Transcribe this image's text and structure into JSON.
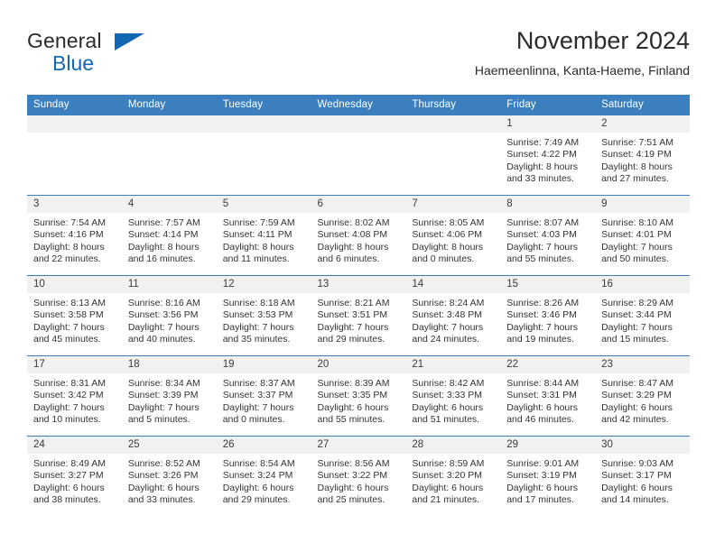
{
  "brand": {
    "line1": "General",
    "line2": "Blue",
    "flag_icon": "triangle-flag-icon",
    "color": "#1268b3"
  },
  "header": {
    "title": "November 2024",
    "subtitle": "Haemeenlinna, Kanta-Haeme, Finland"
  },
  "theme": {
    "header_blue": "#3c7fbf",
    "daynum_bg": "#f1f1f1",
    "text": "#333333"
  },
  "weekday_headers": [
    "Sunday",
    "Monday",
    "Tuesday",
    "Wednesday",
    "Thursday",
    "Friday",
    "Saturday"
  ],
  "weeks": [
    [
      {
        "day": "",
        "sunrise": "",
        "sunset": "",
        "daylight1": "",
        "daylight2": ""
      },
      {
        "day": "",
        "sunrise": "",
        "sunset": "",
        "daylight1": "",
        "daylight2": ""
      },
      {
        "day": "",
        "sunrise": "",
        "sunset": "",
        "daylight1": "",
        "daylight2": ""
      },
      {
        "day": "",
        "sunrise": "",
        "sunset": "",
        "daylight1": "",
        "daylight2": ""
      },
      {
        "day": "",
        "sunrise": "",
        "sunset": "",
        "daylight1": "",
        "daylight2": ""
      },
      {
        "day": "1",
        "sunrise": "Sunrise: 7:49 AM",
        "sunset": "Sunset: 4:22 PM",
        "daylight1": "Daylight: 8 hours",
        "daylight2": "and 33 minutes."
      },
      {
        "day": "2",
        "sunrise": "Sunrise: 7:51 AM",
        "sunset": "Sunset: 4:19 PM",
        "daylight1": "Daylight: 8 hours",
        "daylight2": "and 27 minutes."
      }
    ],
    [
      {
        "day": "3",
        "sunrise": "Sunrise: 7:54 AM",
        "sunset": "Sunset: 4:16 PM",
        "daylight1": "Daylight: 8 hours",
        "daylight2": "and 22 minutes."
      },
      {
        "day": "4",
        "sunrise": "Sunrise: 7:57 AM",
        "sunset": "Sunset: 4:14 PM",
        "daylight1": "Daylight: 8 hours",
        "daylight2": "and 16 minutes."
      },
      {
        "day": "5",
        "sunrise": "Sunrise: 7:59 AM",
        "sunset": "Sunset: 4:11 PM",
        "daylight1": "Daylight: 8 hours",
        "daylight2": "and 11 minutes."
      },
      {
        "day": "6",
        "sunrise": "Sunrise: 8:02 AM",
        "sunset": "Sunset: 4:08 PM",
        "daylight1": "Daylight: 8 hours",
        "daylight2": "and 6 minutes."
      },
      {
        "day": "7",
        "sunrise": "Sunrise: 8:05 AM",
        "sunset": "Sunset: 4:06 PM",
        "daylight1": "Daylight: 8 hours",
        "daylight2": "and 0 minutes."
      },
      {
        "day": "8",
        "sunrise": "Sunrise: 8:07 AM",
        "sunset": "Sunset: 4:03 PM",
        "daylight1": "Daylight: 7 hours",
        "daylight2": "and 55 minutes."
      },
      {
        "day": "9",
        "sunrise": "Sunrise: 8:10 AM",
        "sunset": "Sunset: 4:01 PM",
        "daylight1": "Daylight: 7 hours",
        "daylight2": "and 50 minutes."
      }
    ],
    [
      {
        "day": "10",
        "sunrise": "Sunrise: 8:13 AM",
        "sunset": "Sunset: 3:58 PM",
        "daylight1": "Daylight: 7 hours",
        "daylight2": "and 45 minutes."
      },
      {
        "day": "11",
        "sunrise": "Sunrise: 8:16 AM",
        "sunset": "Sunset: 3:56 PM",
        "daylight1": "Daylight: 7 hours",
        "daylight2": "and 40 minutes."
      },
      {
        "day": "12",
        "sunrise": "Sunrise: 8:18 AM",
        "sunset": "Sunset: 3:53 PM",
        "daylight1": "Daylight: 7 hours",
        "daylight2": "and 35 minutes."
      },
      {
        "day": "13",
        "sunrise": "Sunrise: 8:21 AM",
        "sunset": "Sunset: 3:51 PM",
        "daylight1": "Daylight: 7 hours",
        "daylight2": "and 29 minutes."
      },
      {
        "day": "14",
        "sunrise": "Sunrise: 8:24 AM",
        "sunset": "Sunset: 3:48 PM",
        "daylight1": "Daylight: 7 hours",
        "daylight2": "and 24 minutes."
      },
      {
        "day": "15",
        "sunrise": "Sunrise: 8:26 AM",
        "sunset": "Sunset: 3:46 PM",
        "daylight1": "Daylight: 7 hours",
        "daylight2": "and 19 minutes."
      },
      {
        "day": "16",
        "sunrise": "Sunrise: 8:29 AM",
        "sunset": "Sunset: 3:44 PM",
        "daylight1": "Daylight: 7 hours",
        "daylight2": "and 15 minutes."
      }
    ],
    [
      {
        "day": "17",
        "sunrise": "Sunrise: 8:31 AM",
        "sunset": "Sunset: 3:42 PM",
        "daylight1": "Daylight: 7 hours",
        "daylight2": "and 10 minutes."
      },
      {
        "day": "18",
        "sunrise": "Sunrise: 8:34 AM",
        "sunset": "Sunset: 3:39 PM",
        "daylight1": "Daylight: 7 hours",
        "daylight2": "and 5 minutes."
      },
      {
        "day": "19",
        "sunrise": "Sunrise: 8:37 AM",
        "sunset": "Sunset: 3:37 PM",
        "daylight1": "Daylight: 7 hours",
        "daylight2": "and 0 minutes."
      },
      {
        "day": "20",
        "sunrise": "Sunrise: 8:39 AM",
        "sunset": "Sunset: 3:35 PM",
        "daylight1": "Daylight: 6 hours",
        "daylight2": "and 55 minutes."
      },
      {
        "day": "21",
        "sunrise": "Sunrise: 8:42 AM",
        "sunset": "Sunset: 3:33 PM",
        "daylight1": "Daylight: 6 hours",
        "daylight2": "and 51 minutes."
      },
      {
        "day": "22",
        "sunrise": "Sunrise: 8:44 AM",
        "sunset": "Sunset: 3:31 PM",
        "daylight1": "Daylight: 6 hours",
        "daylight2": "and 46 minutes."
      },
      {
        "day": "23",
        "sunrise": "Sunrise: 8:47 AM",
        "sunset": "Sunset: 3:29 PM",
        "daylight1": "Daylight: 6 hours",
        "daylight2": "and 42 minutes."
      }
    ],
    [
      {
        "day": "24",
        "sunrise": "Sunrise: 8:49 AM",
        "sunset": "Sunset: 3:27 PM",
        "daylight1": "Daylight: 6 hours",
        "daylight2": "and 38 minutes."
      },
      {
        "day": "25",
        "sunrise": "Sunrise: 8:52 AM",
        "sunset": "Sunset: 3:26 PM",
        "daylight1": "Daylight: 6 hours",
        "daylight2": "and 33 minutes."
      },
      {
        "day": "26",
        "sunrise": "Sunrise: 8:54 AM",
        "sunset": "Sunset: 3:24 PM",
        "daylight1": "Daylight: 6 hours",
        "daylight2": "and 29 minutes."
      },
      {
        "day": "27",
        "sunrise": "Sunrise: 8:56 AM",
        "sunset": "Sunset: 3:22 PM",
        "daylight1": "Daylight: 6 hours",
        "daylight2": "and 25 minutes."
      },
      {
        "day": "28",
        "sunrise": "Sunrise: 8:59 AM",
        "sunset": "Sunset: 3:20 PM",
        "daylight1": "Daylight: 6 hours",
        "daylight2": "and 21 minutes."
      },
      {
        "day": "29",
        "sunrise": "Sunrise: 9:01 AM",
        "sunset": "Sunset: 3:19 PM",
        "daylight1": "Daylight: 6 hours",
        "daylight2": "and 17 minutes."
      },
      {
        "day": "30",
        "sunrise": "Sunrise: 9:03 AM",
        "sunset": "Sunset: 3:17 PM",
        "daylight1": "Daylight: 6 hours",
        "daylight2": "and 14 minutes."
      }
    ]
  ]
}
